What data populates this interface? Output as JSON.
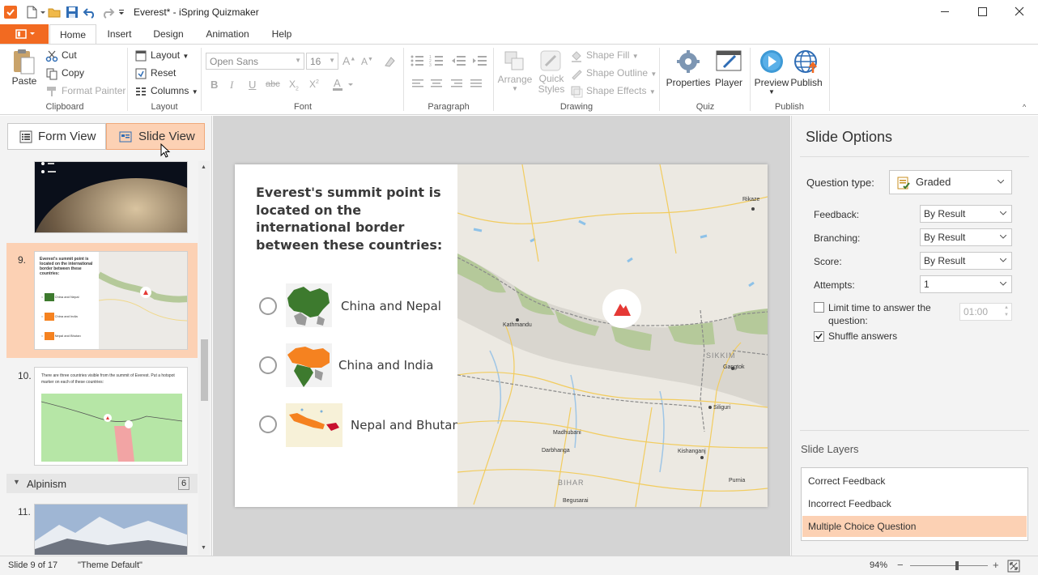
{
  "window": {
    "title": "Everest* - iSpring Quizmaker"
  },
  "ribbon": {
    "tabs": [
      "Home",
      "Insert",
      "Design",
      "Animation",
      "Help"
    ],
    "active_tab": "Home",
    "clipboard": {
      "paste": "Paste",
      "cut": "Cut",
      "copy": "Copy",
      "format_painter": "Format Painter",
      "label": "Clipboard"
    },
    "layout": {
      "layout": "Layout",
      "reset": "Reset",
      "columns": "Columns",
      "label": "Layout"
    },
    "font": {
      "family": "Open Sans",
      "size": "16",
      "label": "Font"
    },
    "paragraph": {
      "label": "Paragraph"
    },
    "drawing": {
      "arrange": "Arrange",
      "quick_styles_1": "Quick",
      "quick_styles_2": "Styles",
      "shape_fill": "Shape Fill",
      "shape_outline": "Shape Outline",
      "shape_effects": "Shape Effects",
      "label": "Drawing"
    },
    "quiz": {
      "properties": "Properties",
      "player": "Player",
      "label": "Quiz"
    },
    "publish": {
      "preview": "Preview",
      "publish": "Publish",
      "label": "Publish"
    }
  },
  "left_pane": {
    "form_view": "Form View",
    "slide_view": "Slide View",
    "slides": [
      {
        "num": "9.",
        "selected": true,
        "q": "Everest's summit point is located on the international border between these countries:",
        "opts": [
          "China and Nepal",
          "China and India",
          "Nepal and Bhutan"
        ]
      },
      {
        "num": "10.",
        "selected": false,
        "q": "There are three countries visible from the summit of Everest. Put a hotspot marker on each of these countries:"
      },
      {
        "num": "11.",
        "selected": false
      }
    ],
    "group": {
      "name": "Alpinism",
      "count": "6"
    }
  },
  "slide": {
    "question": "Everest's summit point is located on the international border between these countries:",
    "options": [
      "China and Nepal",
      "China and India",
      "Nepal and Bhutan"
    ],
    "map_labels": {
      "kathmandu": "Kathmandu",
      "sikkim": "SIKKIM",
      "bihar": "BIHAR",
      "gangtok": "Gangtok",
      "siliguri": "Siliguri",
      "kishanganj": "Kishanganj",
      "darbhanga": "Darbhanga",
      "madhubani": "Madhubani",
      "begusarai": "Begusarai",
      "purnia": "Purnia",
      "rikaze": "Rikaze"
    }
  },
  "slide_options": {
    "title": "Slide Options",
    "question_type_label": "Question type:",
    "question_type": "Graded",
    "feedback_label": "Feedback:",
    "feedback": "By Result",
    "branching_label": "Branching:",
    "branching": "By Result",
    "score_label": "Score:",
    "score": "By Result",
    "attempts_label": "Attempts:",
    "attempts": "1",
    "limit_time_1": "Limit time to answer the",
    "limit_time_2": "question:",
    "limit_time_checked": false,
    "time_value": "01:00",
    "shuffle_answers": "Shuffle answers",
    "shuffle_checked": true,
    "layers_title": "Slide Layers",
    "layers": [
      "Correct Feedback",
      "Incorrect Feedback",
      "Multiple Choice Question"
    ],
    "selected_layer": "Multiple Choice Question"
  },
  "status": {
    "slide_info": "Slide 9 of 17",
    "theme": "\"Theme Default\"",
    "zoom": "94%",
    "zoom_fraction": 0.6
  },
  "colors": {
    "accent": "#f26a21",
    "selection": "#fcd1b4",
    "china_green": "#3d7a2e",
    "india_orange": "#f58220",
    "bhutan_red": "#c8102e"
  }
}
